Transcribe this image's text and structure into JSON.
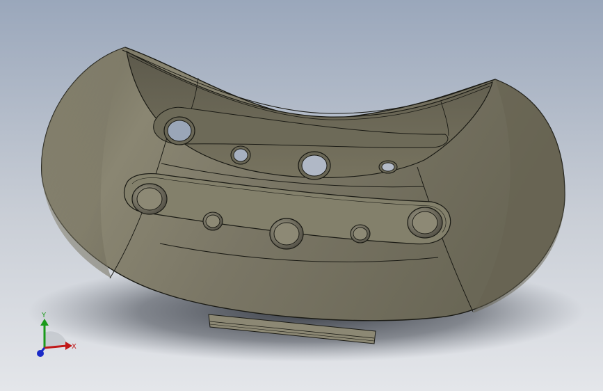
{
  "viewport": {
    "background_top": "#9aa7bb",
    "background_bottom": "#e4e6ea",
    "part_color": "#7b7766",
    "edge_color": "#1a1a14"
  },
  "triad": {
    "x_label": "X",
    "y_label": "Y",
    "x_color": "#c01818",
    "y_color": "#1a9a1a",
    "z_color": "#1a2ac8"
  }
}
